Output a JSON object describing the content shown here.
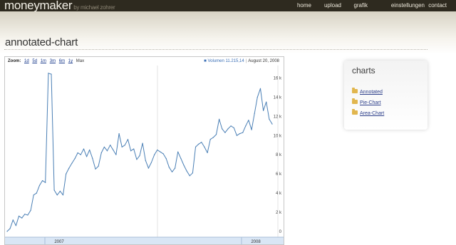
{
  "brand": {
    "name": "moneymaker",
    "byline": "by michael zohrer"
  },
  "nav": [
    "home",
    "upload",
    "grafik",
    "einstellungen",
    "contact"
  ],
  "page": {
    "title": "annotated-chart"
  },
  "chart": {
    "zoom_label": "Zoom:",
    "zoom_options": [
      "1d",
      "5d",
      "1m",
      "3m",
      "6m",
      "1y",
      "Max"
    ],
    "readout_series": "Volumen",
    "readout_value": "11.215,14",
    "readout_date": "August 20, 2008"
  },
  "sidebar": {
    "title": "charts",
    "links": [
      "Annotated",
      "Pie-Chart",
      "Area-Chart"
    ]
  },
  "colors": {
    "topbar": "#2e2a1f",
    "series": "#4a7fb5",
    "link": "#2d3f8a"
  },
  "chart_data": {
    "type": "line",
    "title": "",
    "series": [
      {
        "name": "Volumen",
        "values": [
          0,
          300,
          1200,
          600,
          1600,
          1400,
          1800,
          1700,
          2200,
          3800,
          4000,
          4800,
          5300,
          5100,
          16500,
          16400,
          4300,
          3800,
          4200,
          3800,
          6000,
          6600,
          7100,
          7600,
          8200,
          8000,
          8600,
          7800,
          8500,
          7600,
          6500,
          6800,
          8200,
          8800,
          8400,
          9000,
          8500,
          8000,
          10200,
          8800,
          9000,
          9600,
          8400,
          8600,
          7500,
          7900,
          9200,
          7400,
          6600,
          7200,
          8000,
          8500,
          8300,
          8100,
          7600,
          6700,
          6200,
          6600,
          8300,
          7600,
          6900,
          6300,
          5800,
          6100,
          8800,
          9100,
          9300,
          8800,
          8200,
          9600,
          9800,
          10100,
          11700,
          10700,
          10300,
          10700,
          11000,
          10800,
          10000,
          10200,
          10300,
          11000,
          11600,
          10600,
          12300,
          14000,
          14900,
          12600,
          13500,
          11700,
          11200
        ]
      }
    ],
    "x_tick_labels": [
      "2007",
      "2008"
    ],
    "y_tick_labels": [
      "0",
      "2 k",
      "4 k",
      "6 k",
      "8 k",
      "10 k",
      "12 k",
      "14 k",
      "16 k"
    ],
    "ylim": [
      -600,
      17300
    ],
    "grid": true,
    "legend": "top-right"
  }
}
